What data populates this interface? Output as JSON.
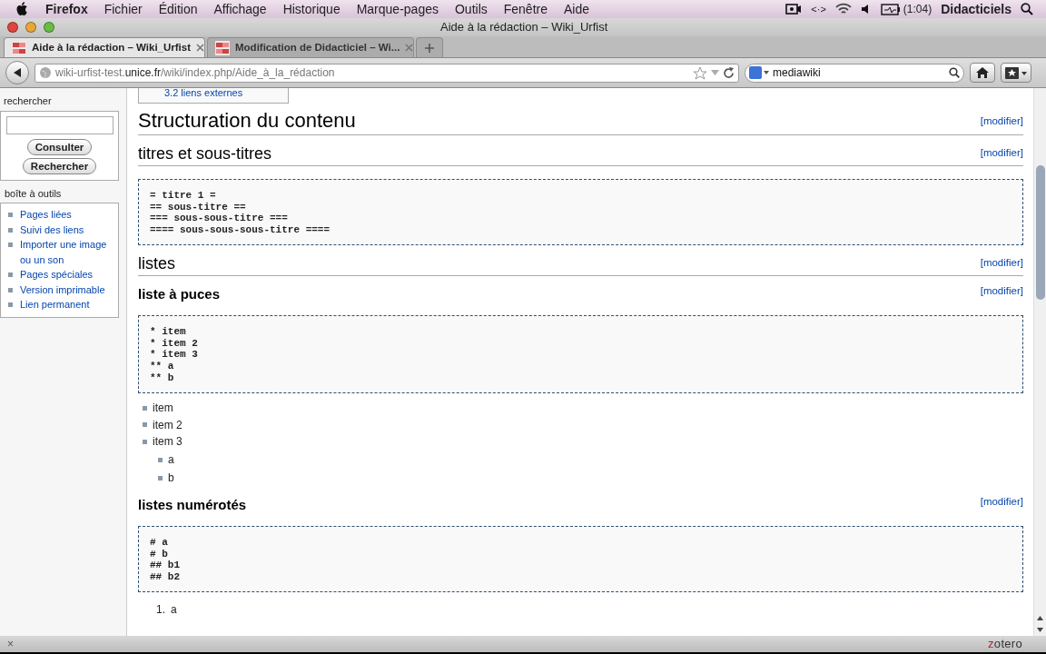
{
  "menubar": {
    "app": "Firefox",
    "items": [
      "Fichier",
      "Édition",
      "Affichage",
      "Historique",
      "Marque-pages",
      "Outils",
      "Fenêtre",
      "Aide"
    ],
    "status_items": [
      "<·>",
      "(1:04)",
      "Didacticiels"
    ]
  },
  "window": {
    "title": "Aide à la rédaction – Wiki_Urfist"
  },
  "tabs": [
    {
      "label": "Aide à la rédaction – Wiki_Urfist",
      "selected": true
    },
    {
      "label": "Modification de Didacticiel – Wi...",
      "selected": false
    }
  ],
  "address_bar": {
    "url": "wiki-urfist-test.**unice.fr**/wiki/index.php/Aide_à_la_rédaction"
  },
  "search_bar": {
    "value": "mediawiki"
  },
  "sidebar": {
    "search_title": "rechercher",
    "buttons": [
      "Consulter",
      "Rechercher"
    ],
    "toolbox_title": "boîte à outils",
    "links": [
      "Pages liées",
      "Suivi des liens",
      "Importer une image ou un son",
      "Pages spéciales",
      "Version imprimable",
      "Lien permanent"
    ]
  },
  "content": {
    "toc_fragment": "3.2 liens externes",
    "blocks": [
      {
        "kind": "h1",
        "text": "Structuration du contenu",
        "edit": "[modifier]"
      },
      {
        "kind": "h2",
        "text": "titres et sous-titres",
        "edit": "[modifier]"
      },
      {
        "kind": "pre",
        "lines": [
          "= titre 1 =",
          "== sous-titre ==",
          "=== sous-sous-titre ===",
          "==== sous-sous-sous-titre ===="
        ]
      },
      {
        "kind": "h2",
        "text": "listes",
        "edit": "[modifier]"
      },
      {
        "kind": "h3",
        "text": "liste à puces",
        "edit": "[modifier]"
      },
      {
        "kind": "pre",
        "lines": [
          "* item",
          "* item 2",
          "* item 3",
          "** a",
          "** b"
        ]
      },
      {
        "kind": "ul",
        "items": [
          {
            "text": "item"
          },
          {
            "text": "item 2"
          },
          {
            "text": "item 3",
            "children": [
              {
                "text": "a"
              },
              {
                "text": "b"
              }
            ]
          }
        ]
      },
      {
        "kind": "h3",
        "text": "listes numérotés",
        "edit": "[modifier]"
      },
      {
        "kind": "pre",
        "lines": [
          "# a",
          "# b",
          "## b1",
          "## b2"
        ]
      },
      {
        "kind": "ol",
        "items": [
          {
            "number": "1.",
            "text": "a"
          }
        ]
      }
    ]
  },
  "status_bar": {
    "close": "×",
    "addon": "zotero"
  }
}
